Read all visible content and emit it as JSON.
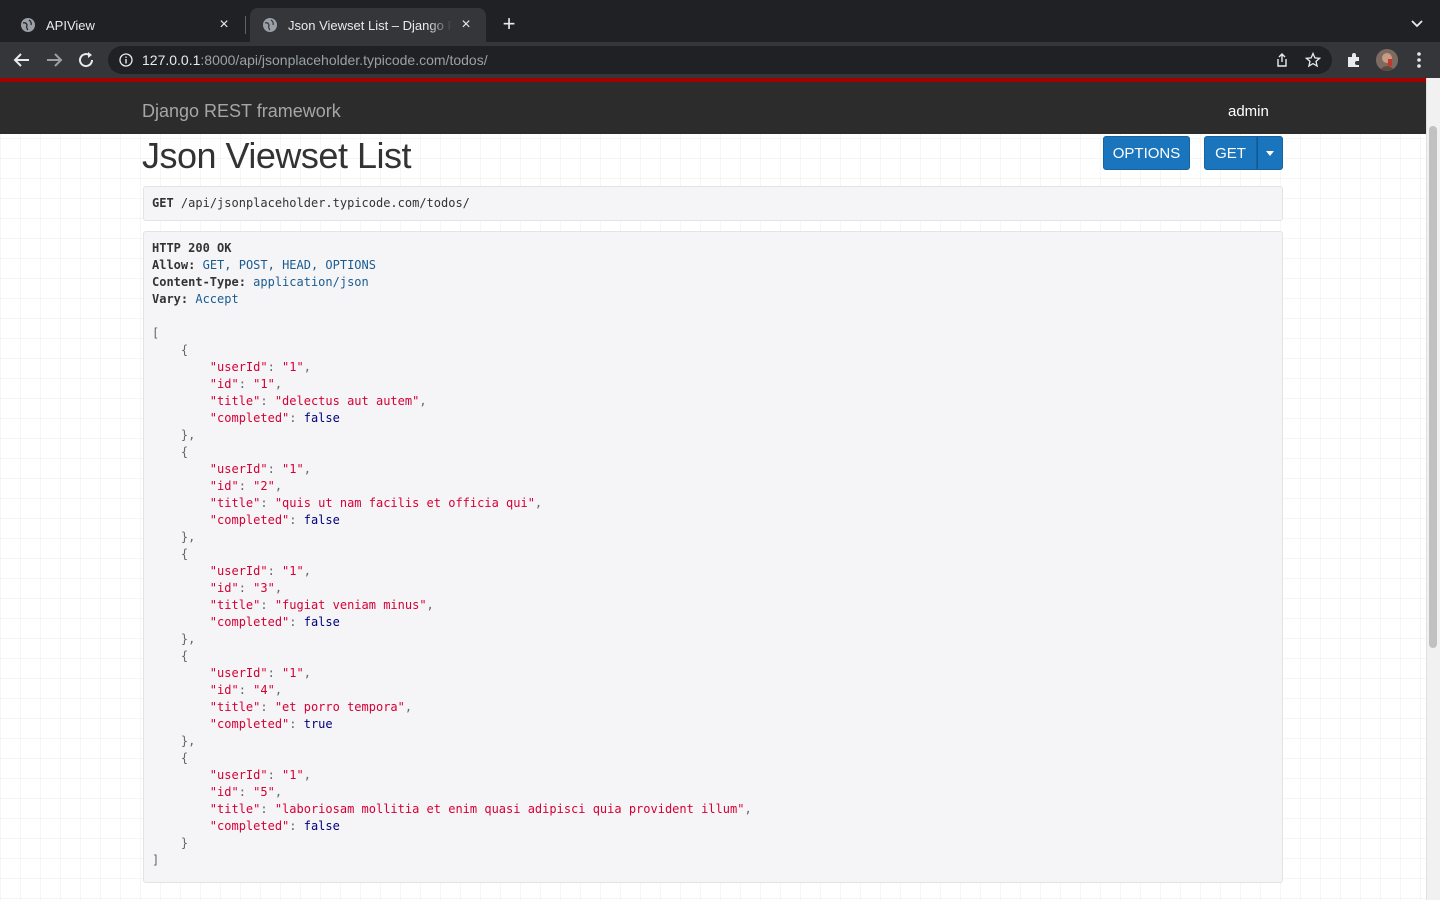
{
  "browser": {
    "tabs": [
      {
        "title": "APIView",
        "active": false
      },
      {
        "title": "Json Viewset List – Django REST framework",
        "active": true
      }
    ],
    "url": {
      "host": "127.0.0.1",
      "rest": ":8000/api/jsonplaceholder.typicode.com/todos/"
    }
  },
  "navbar": {
    "brand": "Django REST framework",
    "user": "admin"
  },
  "page": {
    "title": "Json Viewset List",
    "buttons": {
      "options": "OPTIONS",
      "get": "GET"
    }
  },
  "request": {
    "method": "GET",
    "path": "/api/jsonplaceholder.typicode.com/todos/"
  },
  "response": {
    "status": "HTTP 200 OK",
    "headers": [
      {
        "name": "Allow:",
        "value": "GET, POST, HEAD, OPTIONS"
      },
      {
        "name": "Content-Type:",
        "value": "application/json"
      },
      {
        "name": "Vary:",
        "value": "Accept"
      }
    ],
    "items": [
      {
        "userId": "1",
        "id": "1",
        "title": "delectus aut autem",
        "completed": "false"
      },
      {
        "userId": "1",
        "id": "2",
        "title": "quis ut nam facilis et officia qui",
        "completed": "false"
      },
      {
        "userId": "1",
        "id": "3",
        "title": "fugiat veniam minus",
        "completed": "false"
      },
      {
        "userId": "1",
        "id": "4",
        "title": "et porro tempora",
        "completed": "true"
      },
      {
        "userId": "1",
        "id": "5",
        "title": "laboriosam mollitia et enim quasi adipisci quia provident illum",
        "completed": "false"
      }
    ]
  },
  "colors": {
    "navbar_bg": "#2c2c2c",
    "navbar_accent": "#a30000",
    "button": "#1a75bc",
    "json_string": "#d60036",
    "json_keyword": "#00007a"
  }
}
